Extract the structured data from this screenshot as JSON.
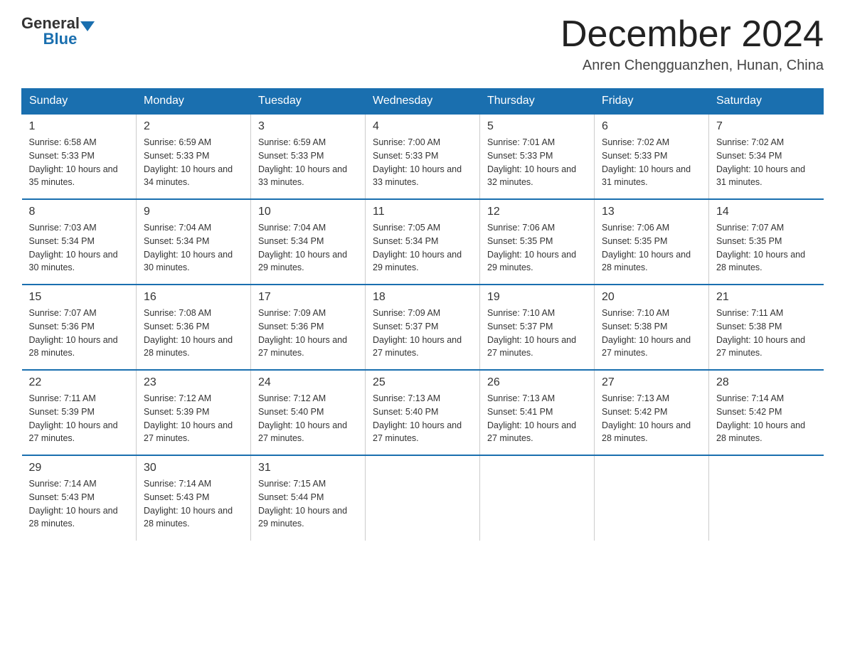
{
  "header": {
    "logo_general": "General",
    "logo_blue": "Blue",
    "month_title": "December 2024",
    "location": "Anren Chengguanzhen, Hunan, China"
  },
  "days_of_week": [
    "Sunday",
    "Monday",
    "Tuesday",
    "Wednesday",
    "Thursday",
    "Friday",
    "Saturday"
  ],
  "weeks": [
    [
      {
        "day": "1",
        "sunrise": "6:58 AM",
        "sunset": "5:33 PM",
        "daylight": "10 hours and 35 minutes."
      },
      {
        "day": "2",
        "sunrise": "6:59 AM",
        "sunset": "5:33 PM",
        "daylight": "10 hours and 34 minutes."
      },
      {
        "day": "3",
        "sunrise": "6:59 AM",
        "sunset": "5:33 PM",
        "daylight": "10 hours and 33 minutes."
      },
      {
        "day": "4",
        "sunrise": "7:00 AM",
        "sunset": "5:33 PM",
        "daylight": "10 hours and 33 minutes."
      },
      {
        "day": "5",
        "sunrise": "7:01 AM",
        "sunset": "5:33 PM",
        "daylight": "10 hours and 32 minutes."
      },
      {
        "day": "6",
        "sunrise": "7:02 AM",
        "sunset": "5:33 PM",
        "daylight": "10 hours and 31 minutes."
      },
      {
        "day": "7",
        "sunrise": "7:02 AM",
        "sunset": "5:34 PM",
        "daylight": "10 hours and 31 minutes."
      }
    ],
    [
      {
        "day": "8",
        "sunrise": "7:03 AM",
        "sunset": "5:34 PM",
        "daylight": "10 hours and 30 minutes."
      },
      {
        "day": "9",
        "sunrise": "7:04 AM",
        "sunset": "5:34 PM",
        "daylight": "10 hours and 30 minutes."
      },
      {
        "day": "10",
        "sunrise": "7:04 AM",
        "sunset": "5:34 PM",
        "daylight": "10 hours and 29 minutes."
      },
      {
        "day": "11",
        "sunrise": "7:05 AM",
        "sunset": "5:34 PM",
        "daylight": "10 hours and 29 minutes."
      },
      {
        "day": "12",
        "sunrise": "7:06 AM",
        "sunset": "5:35 PM",
        "daylight": "10 hours and 29 minutes."
      },
      {
        "day": "13",
        "sunrise": "7:06 AM",
        "sunset": "5:35 PM",
        "daylight": "10 hours and 28 minutes."
      },
      {
        "day": "14",
        "sunrise": "7:07 AM",
        "sunset": "5:35 PM",
        "daylight": "10 hours and 28 minutes."
      }
    ],
    [
      {
        "day": "15",
        "sunrise": "7:07 AM",
        "sunset": "5:36 PM",
        "daylight": "10 hours and 28 minutes."
      },
      {
        "day": "16",
        "sunrise": "7:08 AM",
        "sunset": "5:36 PM",
        "daylight": "10 hours and 28 minutes."
      },
      {
        "day": "17",
        "sunrise": "7:09 AM",
        "sunset": "5:36 PM",
        "daylight": "10 hours and 27 minutes."
      },
      {
        "day": "18",
        "sunrise": "7:09 AM",
        "sunset": "5:37 PM",
        "daylight": "10 hours and 27 minutes."
      },
      {
        "day": "19",
        "sunrise": "7:10 AM",
        "sunset": "5:37 PM",
        "daylight": "10 hours and 27 minutes."
      },
      {
        "day": "20",
        "sunrise": "7:10 AM",
        "sunset": "5:38 PM",
        "daylight": "10 hours and 27 minutes."
      },
      {
        "day": "21",
        "sunrise": "7:11 AM",
        "sunset": "5:38 PM",
        "daylight": "10 hours and 27 minutes."
      }
    ],
    [
      {
        "day": "22",
        "sunrise": "7:11 AM",
        "sunset": "5:39 PM",
        "daylight": "10 hours and 27 minutes."
      },
      {
        "day": "23",
        "sunrise": "7:12 AM",
        "sunset": "5:39 PM",
        "daylight": "10 hours and 27 minutes."
      },
      {
        "day": "24",
        "sunrise": "7:12 AM",
        "sunset": "5:40 PM",
        "daylight": "10 hours and 27 minutes."
      },
      {
        "day": "25",
        "sunrise": "7:13 AM",
        "sunset": "5:40 PM",
        "daylight": "10 hours and 27 minutes."
      },
      {
        "day": "26",
        "sunrise": "7:13 AM",
        "sunset": "5:41 PM",
        "daylight": "10 hours and 27 minutes."
      },
      {
        "day": "27",
        "sunrise": "7:13 AM",
        "sunset": "5:42 PM",
        "daylight": "10 hours and 28 minutes."
      },
      {
        "day": "28",
        "sunrise": "7:14 AM",
        "sunset": "5:42 PM",
        "daylight": "10 hours and 28 minutes."
      }
    ],
    [
      {
        "day": "29",
        "sunrise": "7:14 AM",
        "sunset": "5:43 PM",
        "daylight": "10 hours and 28 minutes."
      },
      {
        "day": "30",
        "sunrise": "7:14 AM",
        "sunset": "5:43 PM",
        "daylight": "10 hours and 28 minutes."
      },
      {
        "day": "31",
        "sunrise": "7:15 AM",
        "sunset": "5:44 PM",
        "daylight": "10 hours and 29 minutes."
      },
      null,
      null,
      null,
      null
    ]
  ],
  "labels": {
    "sunrise_prefix": "Sunrise: ",
    "sunset_prefix": "Sunset: ",
    "daylight_prefix": "Daylight: "
  }
}
